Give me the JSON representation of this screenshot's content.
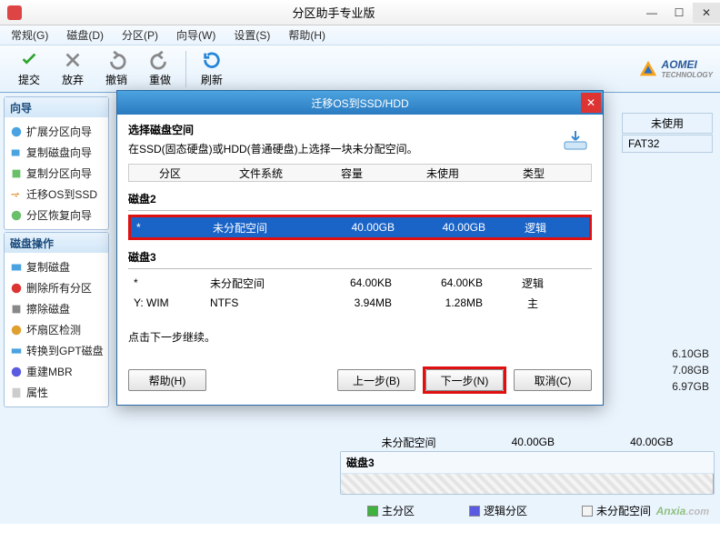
{
  "app": {
    "title": "分区助手专业版"
  },
  "menu": {
    "items": [
      "常规(G)",
      "磁盘(D)",
      "分区(P)",
      "向导(W)",
      "设置(S)",
      "帮助(H)"
    ]
  },
  "toolbar": {
    "commit": "提交",
    "discard": "放弃",
    "undo": "撤销",
    "redo": "重做",
    "refresh": "刷新",
    "brand": "AOMEI",
    "brand_sub": "TECHNOLOGY"
  },
  "sidebar": {
    "wizard_title": "向导",
    "wizard_items": [
      "扩展分区向导",
      "复制磁盘向导",
      "复制分区向导",
      "迁移OS到SSD",
      "分区恢复向导"
    ],
    "disk_title": "磁盘操作",
    "disk_items": [
      "复制磁盘",
      "删除所有分区",
      "擦除磁盘",
      "坏扇区检测",
      "转换到GPT磁盘",
      "重建MBR",
      "属性"
    ]
  },
  "content": {
    "headers": [
      "分区",
      "文件系统",
      "容量",
      "未使用",
      "类型"
    ],
    "fat32": "FAT32",
    "unused_col": "未使用",
    "sizes_right": [
      "6.10GB",
      "7.08GB",
      "6.97GB",
      "40.00GB"
    ],
    "unalloc_label": "未分配空间",
    "unalloc_size": "40.00GB",
    "disk3_label": "磁盘3"
  },
  "legend": {
    "primary": "主分区",
    "logic": "逻辑分区",
    "unalloc": "未分配空间"
  },
  "modal": {
    "title": "迁移OS到SSD/HDD",
    "heading": "选择磁盘空间",
    "instruction": "在SSD(固态硬盘)或HDD(普通硬盘)上选择一块未分配空间。",
    "cols": [
      "分区",
      "文件系统",
      "容量",
      "未使用",
      "类型"
    ],
    "disk2_title": "磁盘2",
    "disk2_row": {
      "part": "*",
      "fs": "未分配空间",
      "cap": "40.00GB",
      "unused": "40.00GB",
      "type": "逻辑"
    },
    "disk3_title": "磁盘3",
    "disk3_rows": [
      {
        "part": "*",
        "fs": "未分配空间",
        "cap": "64.00KB",
        "unused": "64.00KB",
        "type": "逻辑"
      },
      {
        "part": "Y: WIM",
        "fs": "NTFS",
        "cap": "3.94MB",
        "unused": "1.28MB",
        "type": "主"
      }
    ],
    "hint": "点击下一步继续。",
    "help": "帮助(H)",
    "back": "上一步(B)",
    "next": "下一步(N)",
    "cancel": "取消(C)"
  },
  "watermark": {
    "name": "Anxia",
    "dot": ".com"
  }
}
